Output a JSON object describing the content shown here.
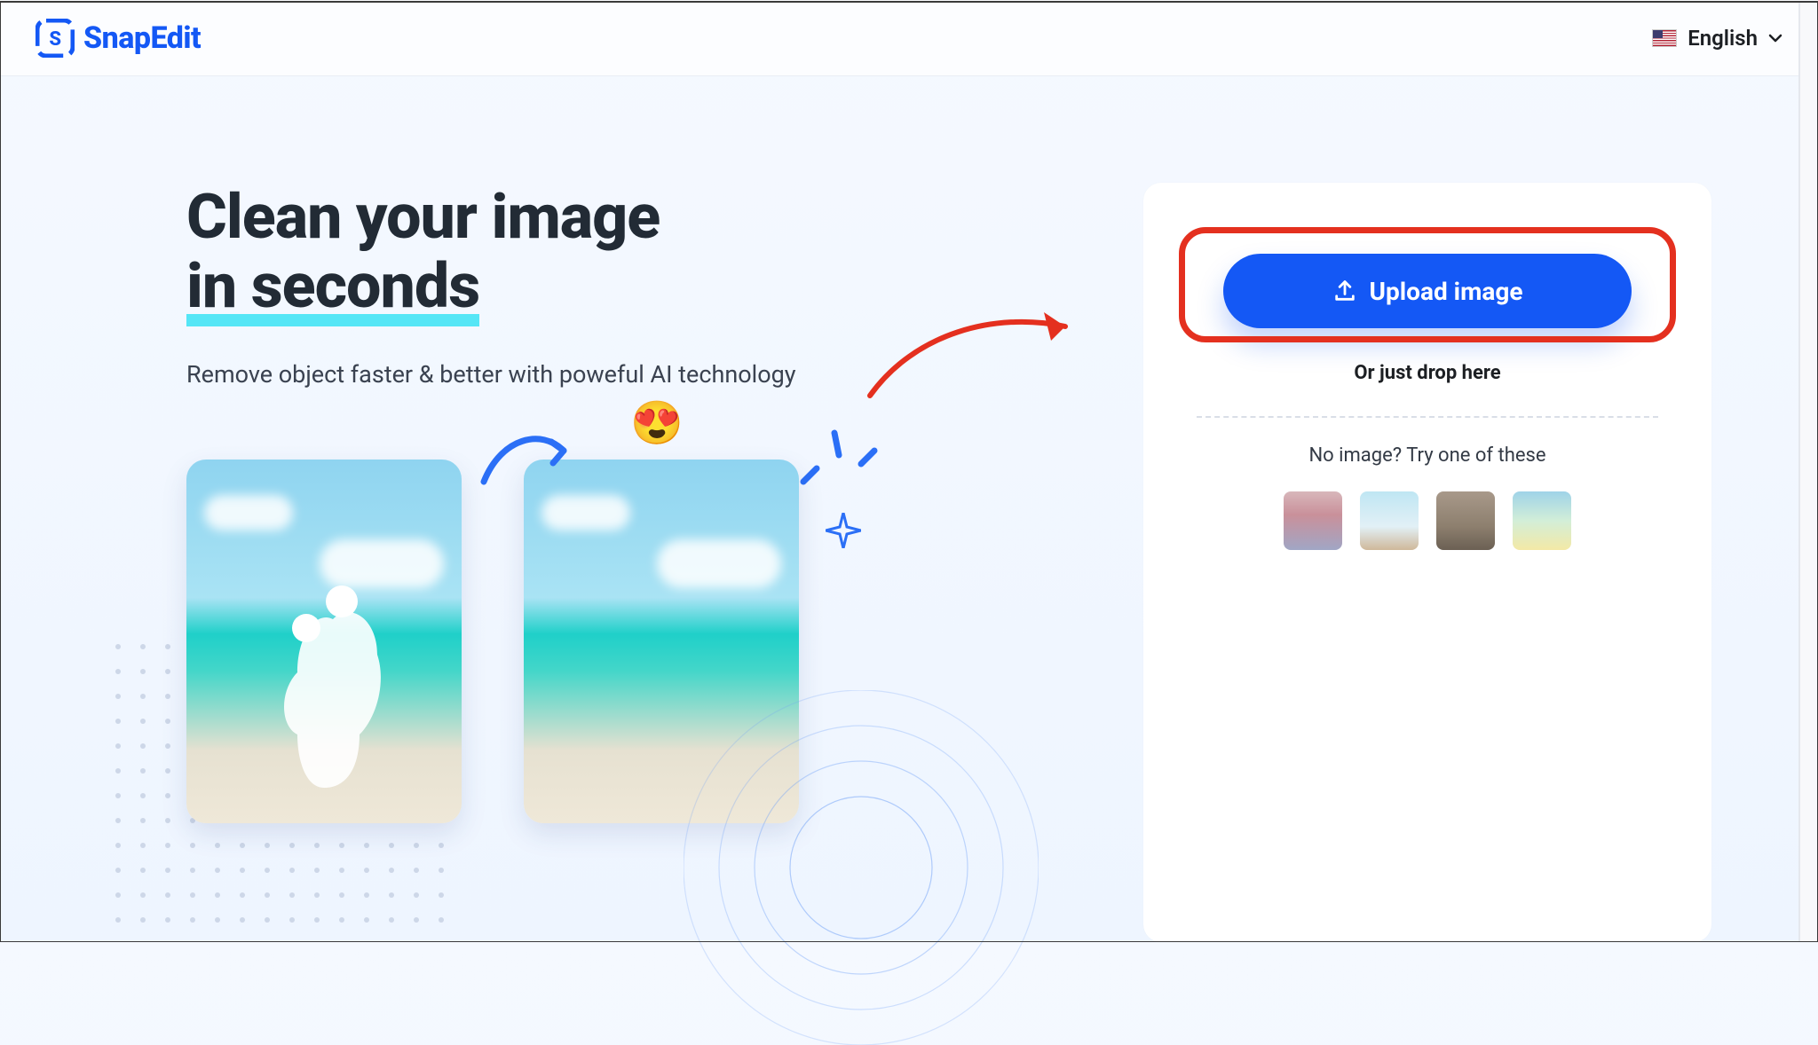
{
  "header": {
    "brand": "SnapEdit",
    "language_label": "English"
  },
  "hero": {
    "title_line1": "Clean your image",
    "title_line2": "in seconds",
    "subtitle": "Remove object faster & better with poweful AI technology"
  },
  "upload": {
    "button_label": "Upload image",
    "drop_label": "Or just drop here",
    "try_label": "No image? Try one of these"
  }
}
